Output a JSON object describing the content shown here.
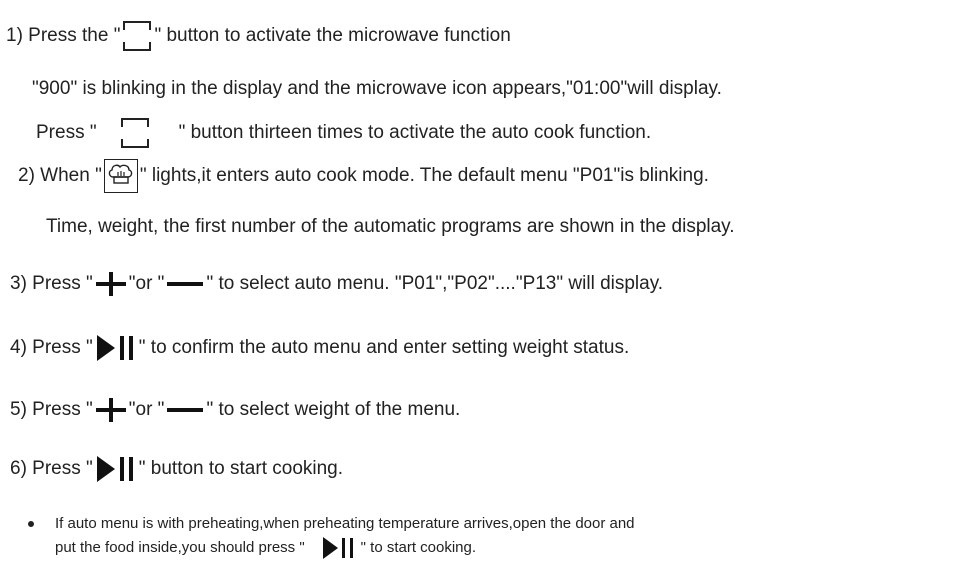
{
  "step1": {
    "a": "1) Press the \"",
    "b": "\" button to activate the microwave function",
    "line2": "\"900\" is blinking in the display and the microwave icon appears,\"01:00\"will display.",
    "line3a": "Press \"",
    "line3b": "\" button thirteen times to activate the auto cook function."
  },
  "step2": {
    "a": "2) When \"",
    "b": "\" lights,it enters auto cook mode. The default menu \"P01\"is blinking.",
    "line2": "Time, weight, the first number of the automatic programs are shown in the display."
  },
  "step3": {
    "a": "3) Press \"",
    "b": "\"or \"",
    "c": "\" to select auto menu.  \"P01\",\"P02\"....\"P13\" will display."
  },
  "step4": {
    "a": "4) Press \"",
    "b": "\"  to confirm the auto menu and enter setting weight status."
  },
  "step5": {
    "a": "5) Press \"",
    "b": "\"or \"",
    "c": "\" to select weight of the menu."
  },
  "step6": {
    "a": "6) Press \"",
    "b": "\" button to start cooking."
  },
  "note": {
    "line1": "If auto menu is with preheating,when preheating temperature arrives,open the door and",
    "line2a": "put the food inside,you should press \"",
    "line2b": "\" to start cooking."
  },
  "icons": {
    "menu": "menu-button-icon",
    "auto_cook": "chef-hat-auto-cook-icon",
    "plus": "plus-icon",
    "minus": "minus-icon",
    "start_pause": "play-pause-icon"
  }
}
